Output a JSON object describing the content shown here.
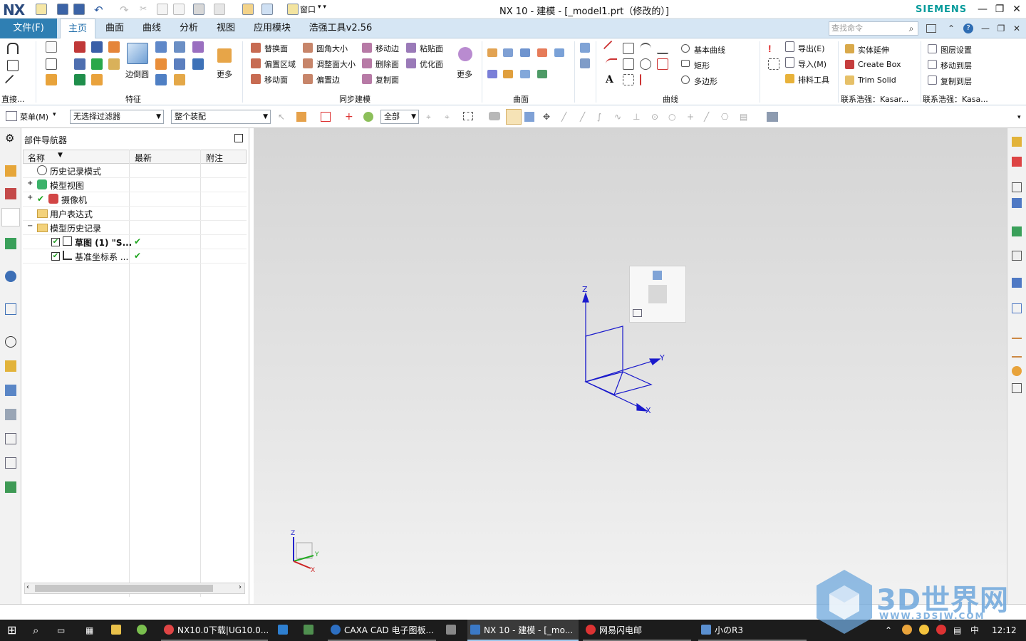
{
  "app": {
    "logo": "NX",
    "window_title": "NX 10 - 建模 - [_model1.prt（修改的）]",
    "brand": "SIEMENS",
    "window_controls": [
      "minimize-icon",
      "restore-icon",
      "close-icon"
    ],
    "window_menu_label": "窗口"
  },
  "menu": {
    "file_tab": "文件(F)",
    "tabs": [
      "主页",
      "曲面",
      "曲线",
      "分析",
      "视图",
      "应用模块",
      "浩强工具v2.56"
    ],
    "active_tab": "主页",
    "search_placeholder": "查找命令"
  },
  "ribbon": {
    "groups": {
      "direct": "直接...",
      "feature": "特征",
      "sync": "同步建模",
      "surface": "曲面",
      "curve": "曲线",
      "contact1": "联系浩强：Kasar...",
      "contact2": "联系浩强：Kasa..."
    },
    "feature": {
      "edge_blend": "边倒圆",
      "more": "更多"
    },
    "sync": {
      "items": [
        "替换面",
        "偏置区域",
        "移动面",
        "圆角大小",
        "调整面大小",
        "偏置边",
        "移动边",
        "删除面",
        "复制面",
        "粘贴面",
        "优化面"
      ],
      "more": "更多"
    },
    "curve": {
      "items": [
        "基本曲线",
        "矩形",
        "多边形"
      ]
    },
    "io": {
      "export": "导出(E)",
      "import": "导入(M)",
      "layout_tool": "排料工具"
    },
    "haoqiang1": {
      "items": [
        "实体延伸",
        "Create Box",
        "Trim Solid"
      ]
    },
    "haoqiang2": {
      "items": [
        "图层设置",
        "移动到层",
        "复制到层"
      ]
    }
  },
  "toolbar2": {
    "menu_label": "菜单(M)",
    "filter": "无选择过滤器",
    "assembly": "整个装配",
    "scope": "全部"
  },
  "navigator": {
    "title": "部件导航器",
    "columns": [
      "名称",
      "最新",
      "附注"
    ],
    "rows": [
      {
        "label": "历史记录模式",
        "bold": false,
        "latest": ""
      },
      {
        "label": "模型视图",
        "bold": false,
        "latest": ""
      },
      {
        "label": "摄像机",
        "bold": false,
        "latest": ""
      },
      {
        "label": "用户表达式",
        "bold": false,
        "latest": ""
      },
      {
        "label": "模型历史记录",
        "bold": false,
        "latest": ""
      },
      {
        "label": "草图 (1) \"S...",
        "bold": true,
        "latest": "✔"
      },
      {
        "label": "基准坐标系 ...",
        "bold": false,
        "latest": "✔"
      }
    ]
  },
  "viewport": {
    "axis_labels": {
      "x": "X",
      "y": "Y",
      "z": "Z"
    },
    "triad_labels": {
      "x": "X",
      "y": "Y",
      "z": "Z"
    },
    "colors": {
      "datum": "#1a1acc",
      "triad_x": "#cc2222",
      "triad_y": "#22aa22",
      "triad_z": "#2222cc"
    }
  },
  "taskbar": {
    "items": [
      "NX10.0下载|UG10.0...",
      "CAXA CAD 电子图板...",
      "NX 10 - 建模 - [_mo...",
      "网易闪电邮",
      "小のR3"
    ],
    "active": "NX 10 - 建模 - [_mo...",
    "ime": "中",
    "time": "12:12"
  },
  "watermark": {
    "text": "3D世界网",
    "sub": "WWW.3DSJW.COM"
  }
}
